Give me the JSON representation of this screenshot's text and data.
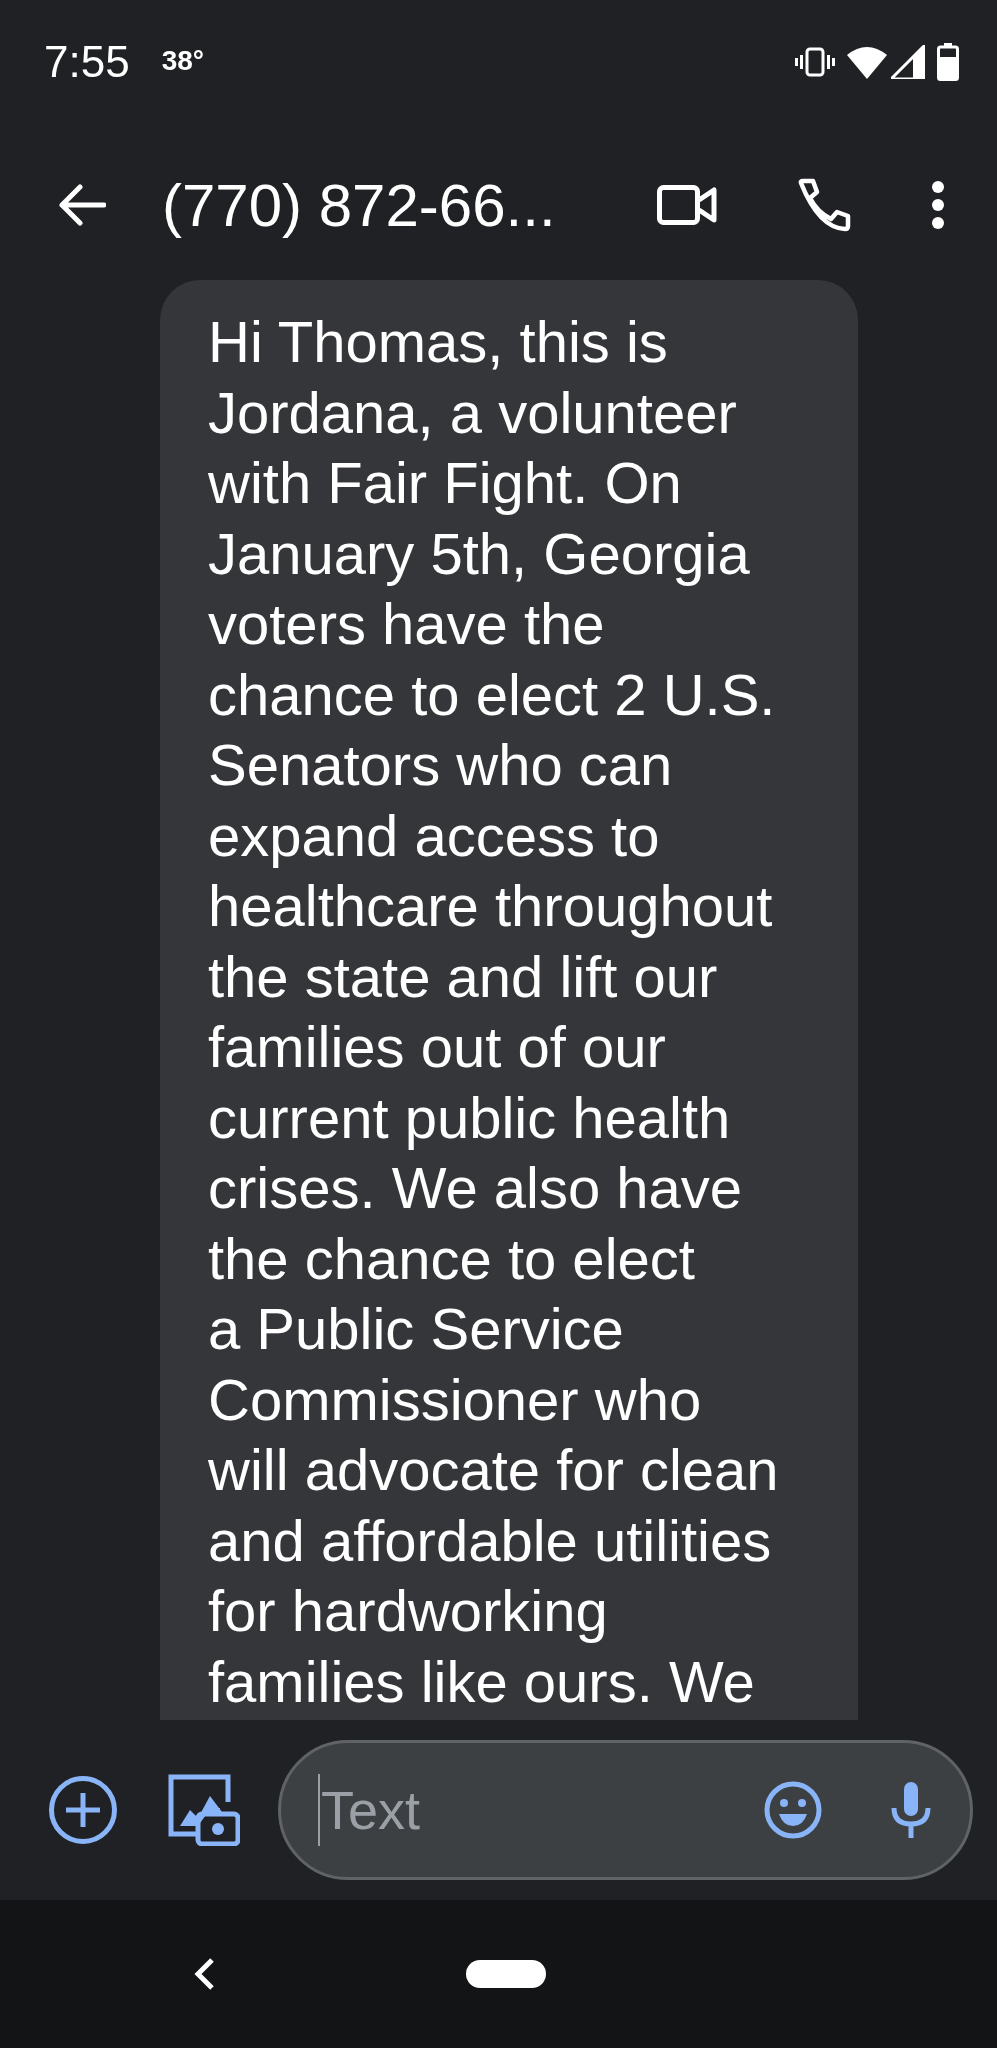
{
  "status_bar": {
    "time": "7:55",
    "temperature": "38°"
  },
  "header": {
    "title": "(770) 872-66..."
  },
  "message": {
    "lines": [
      "Hi Thomas, this is",
      "Jordana, a volunteer",
      "with Fair Fight. On",
      "January 5th, Georgia",
      "voters have the",
      "chance to elect 2 U.S.",
      "Senators who can",
      "expand access to",
      "healthcare throughout",
      "the state and lift our",
      "families out of our",
      "current public health",
      "crises. We also have",
      "the chance to elect",
      "a Public Service",
      "Commissioner who",
      "will advocate for clean",
      "and affordable utilities",
      "for hardworking",
      "families like ours. We"
    ]
  },
  "compose": {
    "placeholder": "Text"
  }
}
